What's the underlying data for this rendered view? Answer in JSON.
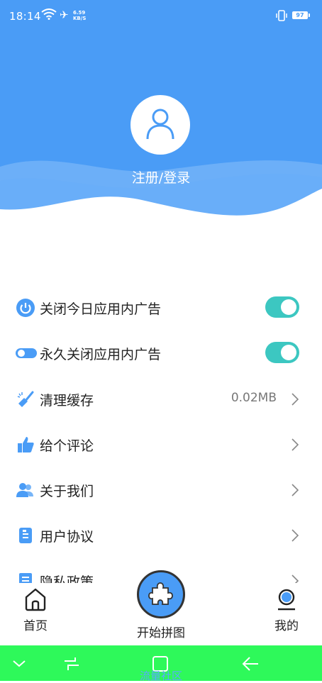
{
  "status_bar": {
    "time": "18:14",
    "net_speed_value": "6.59",
    "net_speed_unit": "KB/S",
    "battery": "97"
  },
  "profile": {
    "login_label": "注册/登录"
  },
  "settings": {
    "items": [
      {
        "label": "关闭今日应用内广告",
        "icon": "power-icon",
        "type": "toggle",
        "on": true
      },
      {
        "label": "永久关闭应用内广告",
        "icon": "switch-icon",
        "type": "toggle",
        "on": true
      },
      {
        "label": "清理缓存",
        "icon": "broom-icon",
        "type": "link",
        "value": "0.02MB"
      },
      {
        "label": "给个评论",
        "icon": "thumbs-up-icon",
        "type": "link"
      },
      {
        "label": "关于我们",
        "icon": "users-icon",
        "type": "link"
      },
      {
        "label": "用户协议",
        "icon": "document-icon",
        "type": "link"
      },
      {
        "label": "隐私政策",
        "icon": "list-icon",
        "type": "link"
      }
    ]
  },
  "bottom_nav": {
    "home_label": "首页",
    "start_label": "开始拼图",
    "me_label": "我的"
  },
  "watermark": "流量社区",
  "colors": {
    "primary": "#4a9cf6",
    "toggle_on": "#3cc7c1",
    "system_bar": "#2ef95a"
  }
}
